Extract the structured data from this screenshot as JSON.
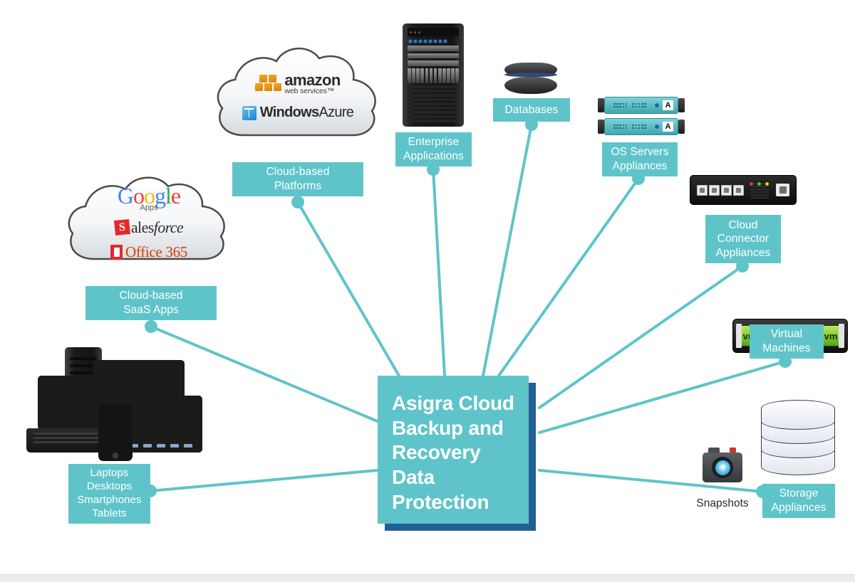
{
  "diagram": {
    "title": "Asigra Cloud Backup and Recovery Data Protection",
    "accent_color": "#5fc4ca",
    "shadow_color": "#225f94",
    "background_color": "#ffffff"
  },
  "hub": {
    "label": "Asigra Cloud\nBackup and\nRecovery\nData\nProtection"
  },
  "nodes": {
    "saas": {
      "label": "Cloud-based\nSaaS Apps",
      "logos": {
        "google": {
          "word": "Google",
          "sub": "Apps"
        },
        "salesforce": {
          "badge": "S",
          "text_a": "ales",
          "text_b": "force"
        },
        "office365": {
          "text": "Office 365"
        }
      }
    },
    "platforms": {
      "label": "Cloud-based\nPlatforms",
      "logos": {
        "aws": {
          "name": "amazon",
          "sub": "web services™"
        },
        "azure": {
          "name_a": "Windows",
          "name_b": "Azure"
        }
      }
    },
    "enterprise": {
      "label": "Enterprise\nApplications"
    },
    "databases": {
      "label": "Databases"
    },
    "os_servers": {
      "label": "OS Servers\nAppliances",
      "badge": "A"
    },
    "cloud_connector": {
      "label": "Cloud\nConnector\nAppliances"
    },
    "virtual_machines": {
      "label": "Virtual\nMachines",
      "tile": "vm"
    },
    "storage": {
      "label": "Storage\nAppliances"
    },
    "snapshots": {
      "label": "Snapshots"
    },
    "endpoints": {
      "label": "Laptops\nDesktops\nSmartphones\nTablets"
    }
  }
}
